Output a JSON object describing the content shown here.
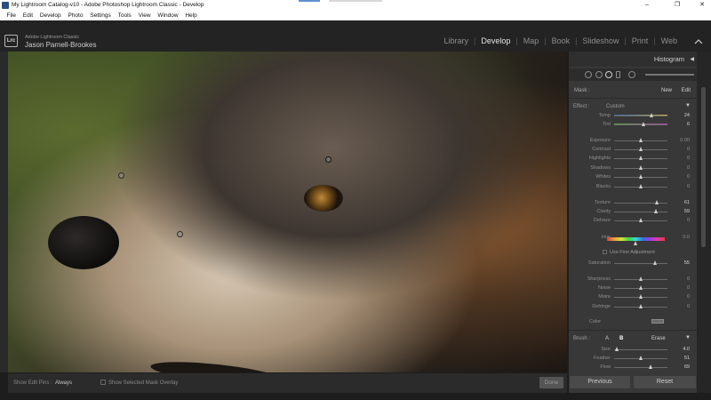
{
  "window": {
    "title": "My Lightroom Catalog-v10 - Adobe Photoshop Lightroom Classic - Develop",
    "minimize_glyph": "–",
    "maximize_glyph": "❐",
    "close_glyph": "✕",
    "icons": {
      "app": "lightroom-app-icon"
    }
  },
  "menu": {
    "items": [
      "File",
      "Edit",
      "Develop",
      "Photo",
      "Settings",
      "Tools",
      "View",
      "Window",
      "Help"
    ]
  },
  "identity": {
    "logo_text": "Lrc",
    "brand": "Adobe Lightroom Classic",
    "user": "Jason Parnell-Brookes"
  },
  "modules": {
    "items": [
      "Library",
      "Develop",
      "Map",
      "Book",
      "Slideshow",
      "Print",
      "Web"
    ],
    "separator": "|",
    "active": "Develop"
  },
  "toolbar": {
    "show_edit_pins_label": "Show Edit Pins :",
    "show_edit_pins_value": "Always",
    "overlay_label": "Show Selected Mask Overlay",
    "done_label": "Done"
  },
  "panel": {
    "histogram_title": "Histogram",
    "collapse_glyph": "◀",
    "mask_label": "Mask :",
    "mask_new": "New",
    "mask_edit": "Edit",
    "effect_label": "Effect :",
    "effect_value": "Custom",
    "effect_dropdown_glyph": "▼",
    "sliders": [
      {
        "label": "Temp",
        "value": "24",
        "position": 0.7,
        "hi": true
      },
      {
        "label": "Tint",
        "value": "6",
        "position": 0.55,
        "hi": true
      },
      {
        "label": "Exposure",
        "value": "0.00",
        "position": 0.5,
        "hi": false
      },
      {
        "label": "Contrast",
        "value": "0",
        "position": 0.5,
        "hi": false
      },
      {
        "label": "Highlights",
        "value": "0",
        "position": 0.5,
        "hi": false
      },
      {
        "label": "Shadows",
        "value": "0",
        "position": 0.5,
        "hi": false
      },
      {
        "label": "Whites",
        "value": "0",
        "position": 0.5,
        "hi": false
      },
      {
        "label": "Blacks",
        "value": "0",
        "position": 0.5,
        "hi": false
      },
      {
        "label": "Texture",
        "value": "61",
        "position": 0.8,
        "hi": true
      },
      {
        "label": "Clarity",
        "value": "59",
        "position": 0.79,
        "hi": true
      },
      {
        "label": "Dehaze",
        "value": "0",
        "position": 0.5,
        "hi": false
      }
    ],
    "hue_label": "Hue",
    "hue_value": "0.0",
    "fine_adjustment_label": "Use Fine Adjustment",
    "saturation": {
      "label": "Saturation",
      "value": "55",
      "position": 0.77
    },
    "detail_sliders": [
      {
        "label": "Sharpness",
        "value": "0",
        "position": 0.5
      },
      {
        "label": "Noise",
        "value": "0",
        "position": 0.5
      },
      {
        "label": "Moire",
        "value": "0",
        "position": 0.5
      },
      {
        "label": "Defringe",
        "value": "0",
        "position": 0.5
      }
    ],
    "color_label": "Color",
    "brush_label": "Brush :",
    "brush_a": "A",
    "brush_b": "B",
    "brush_erase": "Erase",
    "brush_dropdown_glyph": "▼",
    "brush_sliders": [
      {
        "label": "Size",
        "value": "4.0",
        "position": 0.05
      },
      {
        "label": "Feather",
        "value": "51",
        "position": 0.51
      },
      {
        "label": "Flow",
        "value": "69",
        "position": 0.69
      }
    ]
  },
  "buttons": {
    "previous": "Previous",
    "reset": "Reset"
  }
}
